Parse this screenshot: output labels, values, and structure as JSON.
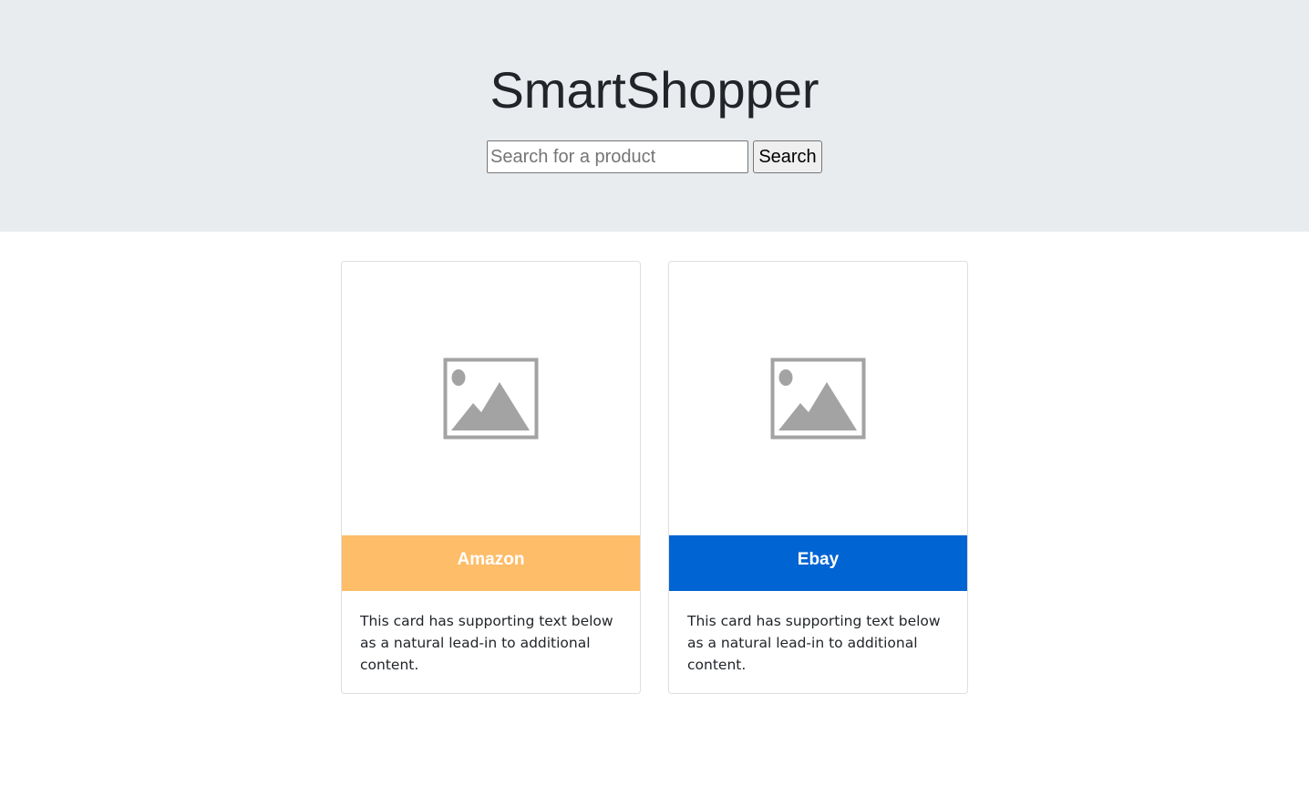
{
  "hero": {
    "title": "SmartShopper",
    "search_placeholder": "Search for a product",
    "search_value": "",
    "search_button_label": "Search",
    "background_color": "#e9ecef"
  },
  "cards": [
    {
      "store_name": "Amazon",
      "header_color": "#febd69",
      "image_icon": "image-placeholder-icon",
      "text": "This card has supporting text below as a natural lead-in to additional content."
    },
    {
      "store_name": "Ebay",
      "header_color": "#0064d2",
      "image_icon": "image-placeholder-icon",
      "text": "This card has supporting text below as a natural lead-in to additional content."
    }
  ]
}
